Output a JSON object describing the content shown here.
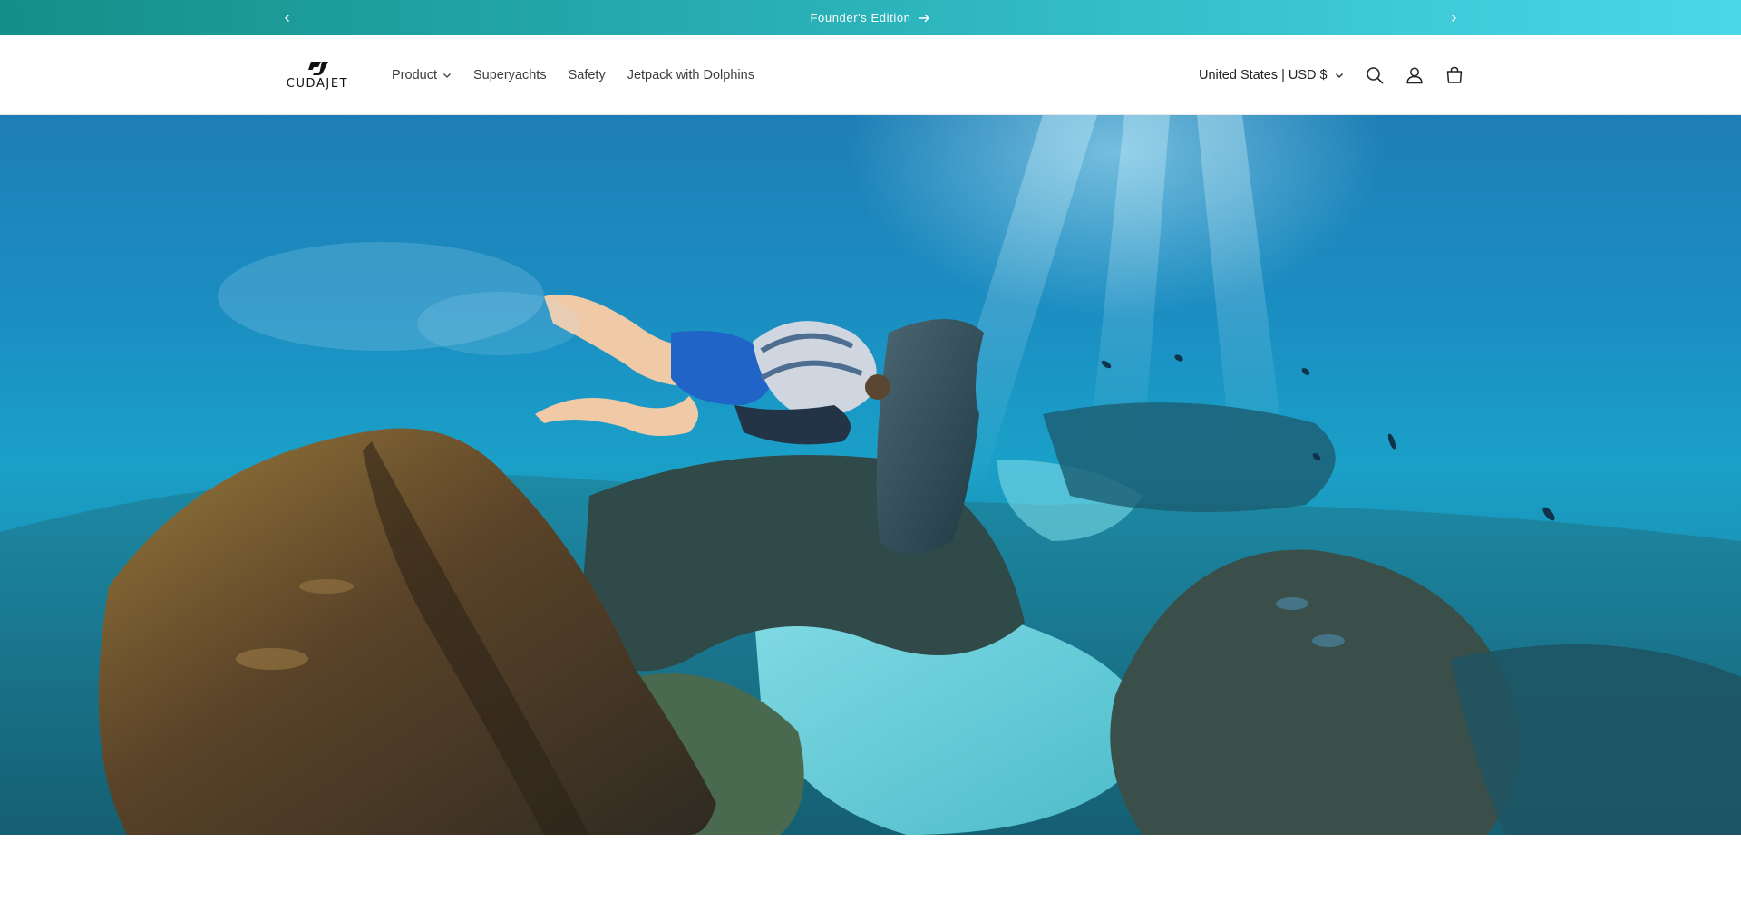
{
  "announcement": {
    "text": "Founder's Edition",
    "prev_icon": "chevron-left-icon",
    "next_icon": "chevron-right-icon",
    "arrow_icon": "arrow-right-icon"
  },
  "header": {
    "logo_text": "CUDAJET",
    "nav": [
      {
        "label": "Product",
        "has_dropdown": true
      },
      {
        "label": "Superyachts"
      },
      {
        "label": "Safety"
      },
      {
        "label": "Jetpack with Dolphins"
      }
    ],
    "locale": "United States | USD $",
    "icons": [
      "search-icon",
      "account-icon",
      "cart-icon"
    ]
  },
  "hero": {
    "media": "underwater-diver-jetpack-image"
  },
  "colors": {
    "announcement_start": "#148f88",
    "announcement_end": "#4ad8e8",
    "header_bg": "#ffffff",
    "nav_text": "#3d3d3d"
  }
}
